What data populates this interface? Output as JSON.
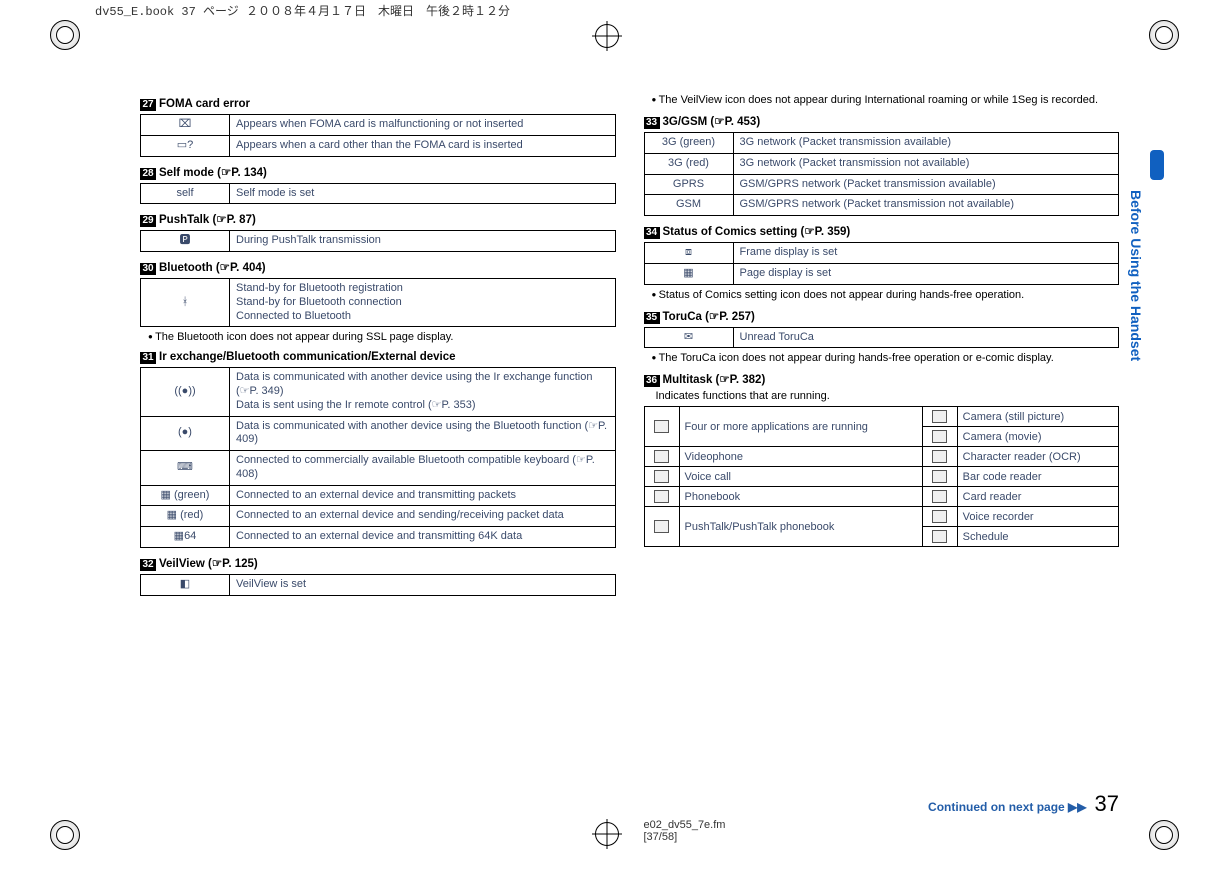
{
  "header": "dv55_E.book  37 ページ  ２００８年４月１７日　木曜日　午後２時１２分",
  "side_tab": "Before Using the Handset",
  "continued": "Continued on next page ▶▶",
  "page_number": "37",
  "footer_fm1": "e02_dv55_7e.fm",
  "footer_fm2": "[37/58]",
  "left": {
    "s27": {
      "num": "27",
      "title": "FOMA card error",
      "rows": [
        {
          "icon": "⌧",
          "desc": "Appears when FOMA card is malfunctioning or not inserted"
        },
        {
          "icon": "▭?",
          "desc": "Appears when a card other than the FOMA card is inserted"
        }
      ]
    },
    "s28": {
      "num": "28",
      "title": "Self mode (☞P. 134)",
      "rows": [
        {
          "icon": "self",
          "desc": "Self mode is set"
        }
      ]
    },
    "s29": {
      "num": "29",
      "title": "PushTalk (☞P. 87)",
      "rows": [
        {
          "icon": "🅿",
          "desc": "During PushTalk transmission"
        }
      ]
    },
    "s30": {
      "num": "30",
      "title": "Bluetooth (☞P. 404)",
      "rows": [
        {
          "icon": "ᚼ",
          "desc": "Stand-by for Bluetooth registration\nStand-by for Bluetooth connection\nConnected to Bluetooth"
        }
      ],
      "note": "The Bluetooth icon does not appear during SSL page display."
    },
    "s31": {
      "num": "31",
      "title": "Ir exchange/Bluetooth communication/External device",
      "rows": [
        {
          "icon": "((●))",
          "desc": "Data is communicated with another device using the Ir exchange function (☞P. 349)\nData is sent using the Ir remote control (☞P. 353)"
        },
        {
          "icon": "(●)",
          "desc": "Data is communicated with another device using the Bluetooth function (☞P. 409)"
        },
        {
          "icon": "⌨",
          "desc": "Connected to commercially available Bluetooth compatible keyboard (☞P. 408)"
        },
        {
          "icon": "▦ (green)",
          "desc": "Connected to an external device and transmitting packets"
        },
        {
          "icon": "▦ (red)",
          "desc": "Connected to an external device and sending/receiving packet data"
        },
        {
          "icon": "▦64",
          "desc": "Connected to an external device and transmitting 64K data"
        }
      ]
    },
    "s32": {
      "num": "32",
      "title": "VeilView (☞P. 125)",
      "rows": [
        {
          "icon": "◧",
          "desc": "VeilView is set"
        }
      ]
    }
  },
  "right": {
    "topnote": "The VeilView icon does not appear during International roaming or while 1Seg is recorded.",
    "s33": {
      "num": "33",
      "title": "3G/GSM (☞P. 453)",
      "rows": [
        {
          "icon": "3G (green)",
          "desc": "3G network (Packet transmission available)"
        },
        {
          "icon": "3G (red)",
          "desc": "3G network (Packet transmission not available)"
        },
        {
          "icon": "GPRS",
          "desc": "GSM/GPRS network (Packet transmission available)"
        },
        {
          "icon": "GSM",
          "desc": "GSM/GPRS network (Packet transmission not available)"
        }
      ]
    },
    "s34": {
      "num": "34",
      "title": "Status of Comics setting (☞P. 359)",
      "rows": [
        {
          "icon": "⧈",
          "desc": "Frame display is set"
        },
        {
          "icon": "▦",
          "desc": "Page display is set"
        }
      ],
      "note": "Status of Comics setting icon does not appear during hands-free operation."
    },
    "s35": {
      "num": "35",
      "title": "ToruCa (☞P. 257)",
      "rows": [
        {
          "icon": "✉",
          "desc": "Unread ToruCa"
        }
      ],
      "note": "The ToruCa icon does not appear during hands-free operation or e-comic display."
    },
    "s36": {
      "num": "36",
      "title": "Multitask (☞P. 382)",
      "sub": "Indicates functions that are running.",
      "table": {
        "left": [
          {
            "icon": "▤",
            "desc": "Four or more applications are running",
            "span": 2
          },
          {
            "icon": "▢",
            "desc": "Videophone"
          },
          {
            "icon": "☎",
            "desc": "Voice call"
          },
          {
            "icon": "📕",
            "desc": "Phonebook"
          },
          {
            "icon": "🅿",
            "desc": "PushTalk/PushTalk phonebook",
            "span": 2
          }
        ],
        "right": [
          {
            "icon": "📷",
            "desc": "Camera (still picture)"
          },
          {
            "icon": "🎥",
            "desc": "Camera (movie)"
          },
          {
            "icon": "🅾",
            "desc": "Character reader (OCR)"
          },
          {
            "icon": "▮▮",
            "desc": "Bar code reader"
          },
          {
            "icon": "💳",
            "desc": "Card reader"
          },
          {
            "icon": "🎤",
            "desc": "Voice recorder"
          },
          {
            "icon": "📅",
            "desc": "Schedule"
          }
        ]
      }
    }
  }
}
